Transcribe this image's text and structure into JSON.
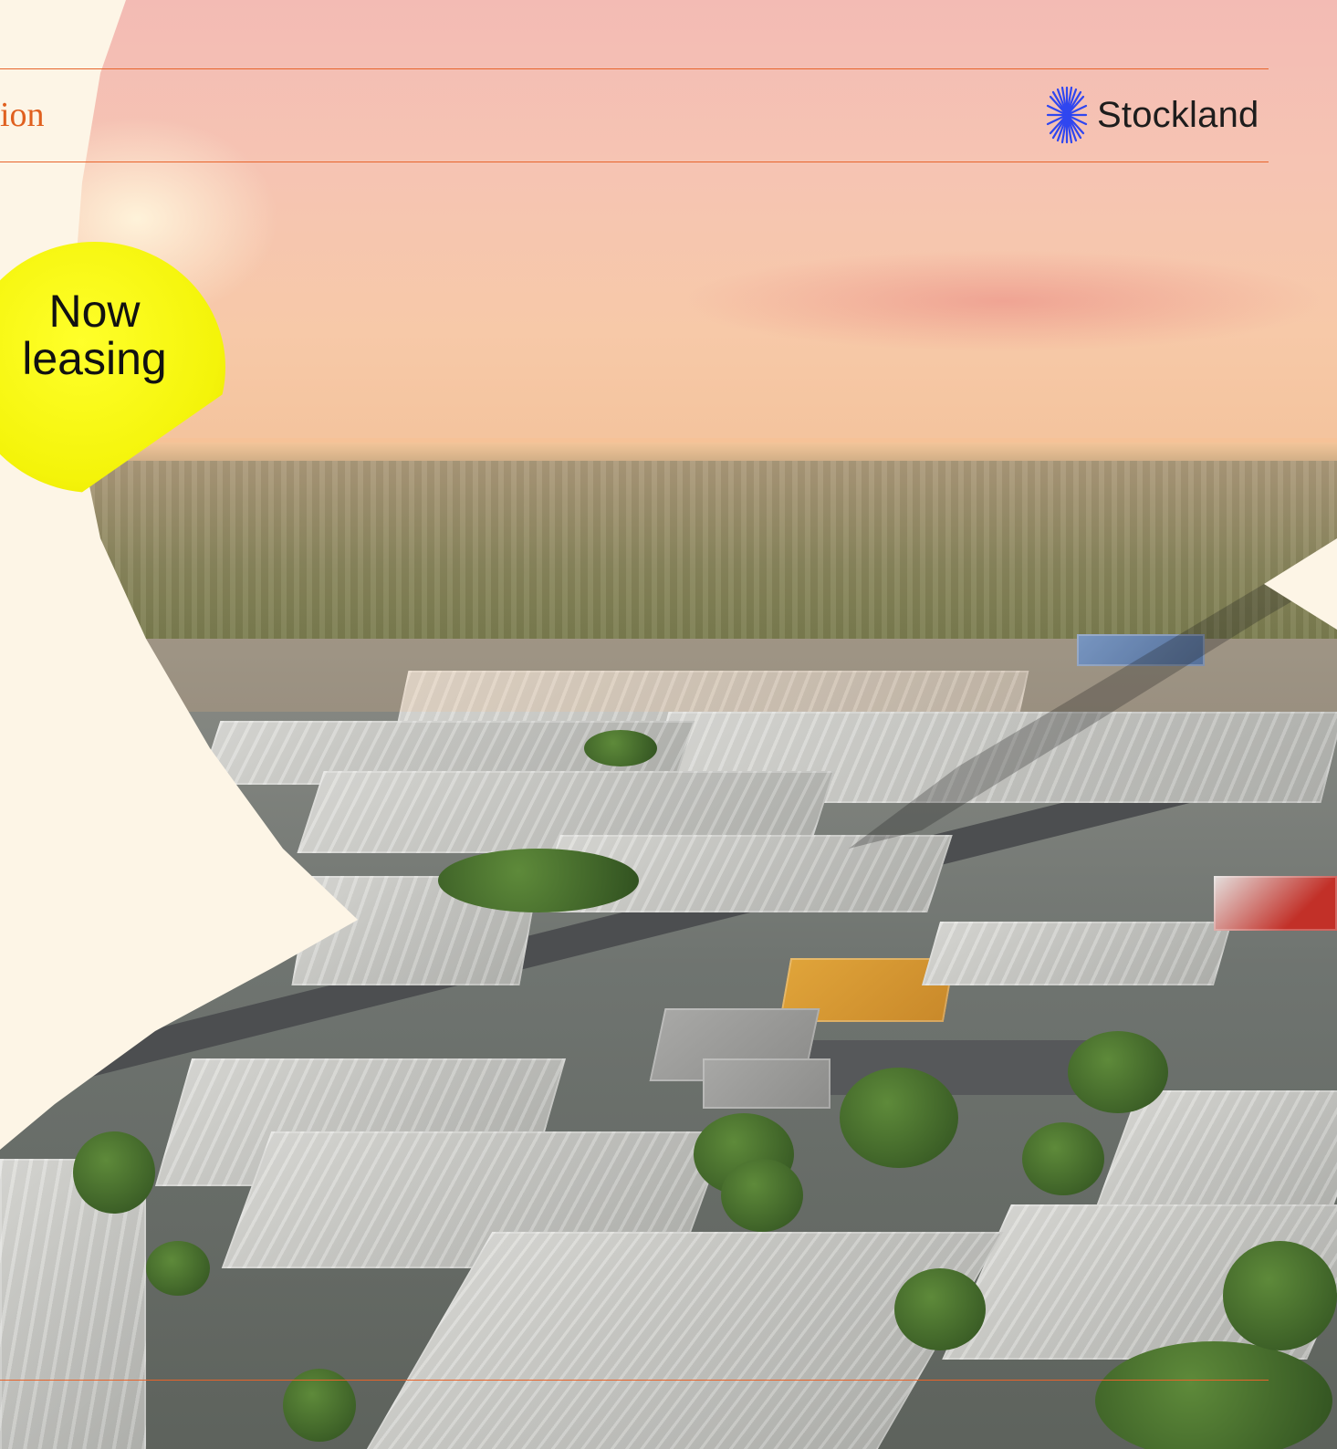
{
  "header": {
    "partial_title": "ion",
    "brand_name": "Stockland"
  },
  "badge": {
    "line1": "Now",
    "line2": "leasing"
  },
  "colors": {
    "accent_rule": "#e8642b",
    "badge_yellow": "#f4f40a",
    "brand_blue": "#2f46f0",
    "cream": "#fdf5e6"
  },
  "icons": {
    "brand_logo": "starburst-icon"
  }
}
